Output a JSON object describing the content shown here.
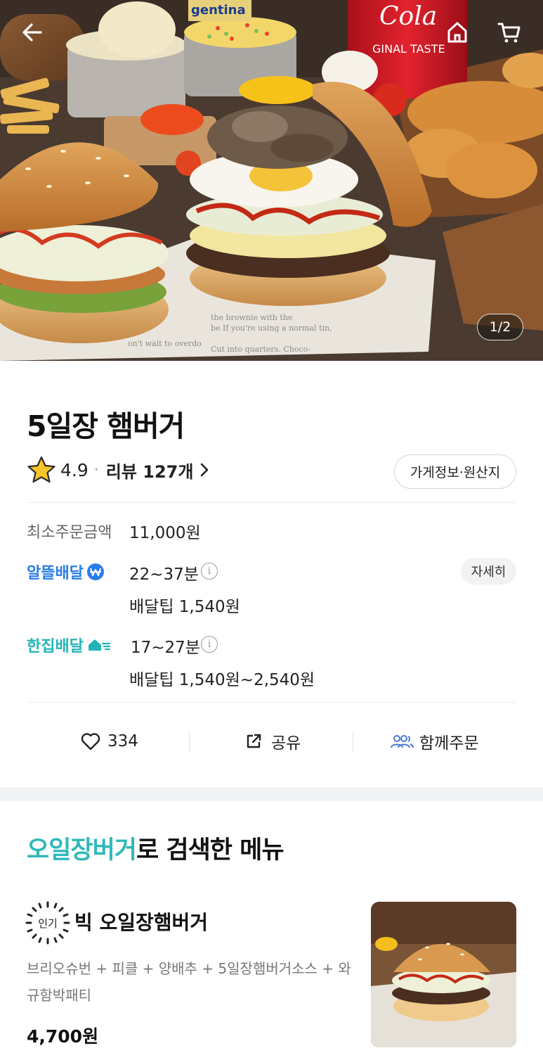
{
  "hero": {
    "image_counter": "1/2",
    "can_texts": [
      "gentina",
      "Cola",
      "GINAL TASTE"
    ],
    "news_texts": [
      "be  If you're using a normal tin,",
      "the brownie with the",
      "on't wait to overdo",
      "Cut into quarters. Choco-"
    ]
  },
  "icons": {
    "back": "arrow-left-icon",
    "home": "home-icon",
    "cart": "cart-icon",
    "star": "star-icon",
    "heart": "heart-icon",
    "share": "share-icon",
    "group": "group-icon"
  },
  "store": {
    "name": "5일장 햄버거",
    "rating": "4.9",
    "rating_separator": "·",
    "review_label": "리뷰 127개",
    "info_button": "가게정보·원산지"
  },
  "order_info": {
    "min_order_label": "최소주문금액",
    "min_order_value": "11,000원",
    "delivery_options": [
      {
        "brand": "알뜰배달",
        "time": "22~37분",
        "tip": "배달팁 1,540원"
      },
      {
        "brand": "한집배달",
        "time": "17~27분",
        "tip": "배달팁 1,540원~2,540원"
      }
    ],
    "detail_button": "자세히",
    "info_glyph": "i"
  },
  "actions": {
    "like_count": "334",
    "share_label": "공유",
    "group_label": "함께주문"
  },
  "menu_section": {
    "highlight": "오일장버거",
    "title_rest": "로 검색한 메뉴",
    "items": [
      {
        "badge": "인기",
        "name": "빅 오일장햄버거",
        "description": "브리오슈번 + 피클 + 양배추 + 5일장햄버거소스 + 와규함박패티",
        "price": "4,700원"
      }
    ]
  },
  "colors": {
    "alttl_blue": "#2b7de9",
    "hanjip_teal": "#23b5b5",
    "section_highlight": "#2fb8b8",
    "group_icon": "#4a77d4"
  }
}
